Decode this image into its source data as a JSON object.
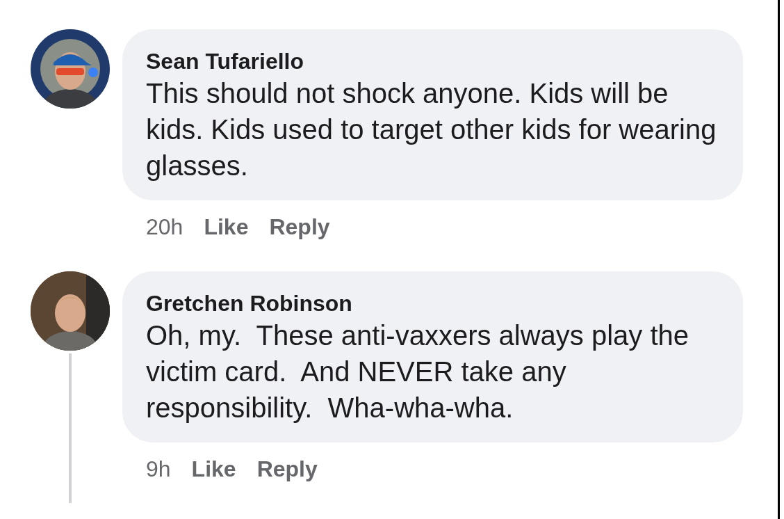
{
  "comments": [
    {
      "author": "Sean Tufariello",
      "text": "This should not shock anyone. Kids will be kids. Kids used to target other kids for wearing glasses.",
      "time": "20h",
      "actions": [
        "Like",
        "Reply"
      ],
      "thread_line": false
    },
    {
      "author": "Gretchen Robinson",
      "text": "Oh, my.  These anti-vaxxers always play the victim card.  And NEVER take any responsibility.  Wha-wha-wha.",
      "time": "9h",
      "actions": [
        "Like",
        "Reply"
      ],
      "thread_line": true
    }
  ]
}
